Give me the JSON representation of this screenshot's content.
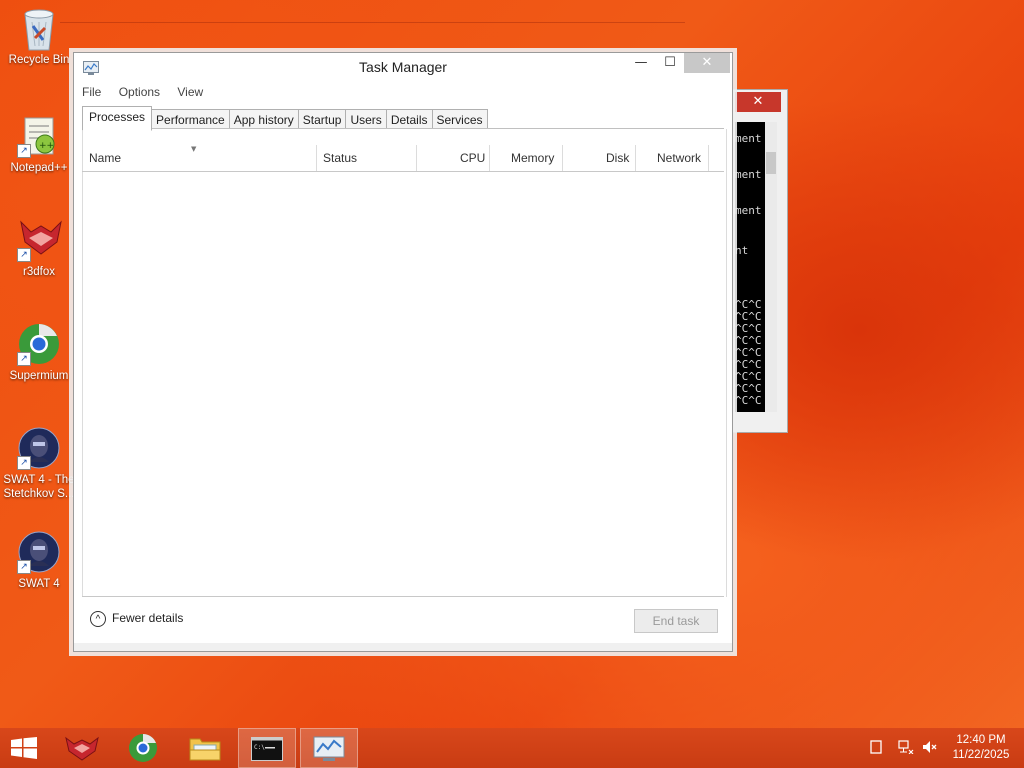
{
  "desktop": {
    "icons": [
      {
        "label": "Recycle Bin",
        "icon": "recycle-bin-icon"
      },
      {
        "label": "Notepad++",
        "icon": "notepad-plus-plus-icon"
      },
      {
        "label": "r3dfox",
        "icon": "r3dfox-icon"
      },
      {
        "label": "Supermium",
        "icon": "supermium-icon"
      },
      {
        "label": "SWAT 4 - The Stetchkov S...",
        "icon": "swat4-stetchkov-icon"
      },
      {
        "label": "SWAT 4",
        "icon": "swat4-icon"
      }
    ]
  },
  "console": {
    "close_glyph": "✕",
    "lines": [
      "ment",
      "ment",
      "ment",
      "nt",
      "^C^C",
      "^C^C",
      "^C^C",
      "^C^C",
      "^C^C",
      "^C^C",
      "^C^C",
      "^C^C",
      "^C^C",
      "^C^C"
    ]
  },
  "task_manager": {
    "title": "Task Manager",
    "minimize_glyph": "—",
    "maximize_glyph": "☐",
    "close_glyph": "✕",
    "menu": [
      "File",
      "Options",
      "View"
    ],
    "tabs": [
      "Processes",
      "Performance",
      "App history",
      "Startup",
      "Users",
      "Details",
      "Services"
    ],
    "active_tab": "Processes",
    "columns": [
      "Name",
      "Status",
      "CPU",
      "Memory",
      "Disk",
      "Network"
    ],
    "fewer_details": "Fewer details",
    "fewer_glyph": "^",
    "end_task": "End task"
  },
  "taskbar": {
    "items": [
      "start-icon",
      "r3dfox-icon",
      "supermium-icon",
      "file-explorer-icon",
      "command-prompt-icon",
      "task-manager-icon"
    ],
    "time": "12:40 PM",
    "date": "11/22/2025",
    "colors": {
      "bar": "#c93c13",
      "accent": "#ee4e0f"
    }
  }
}
